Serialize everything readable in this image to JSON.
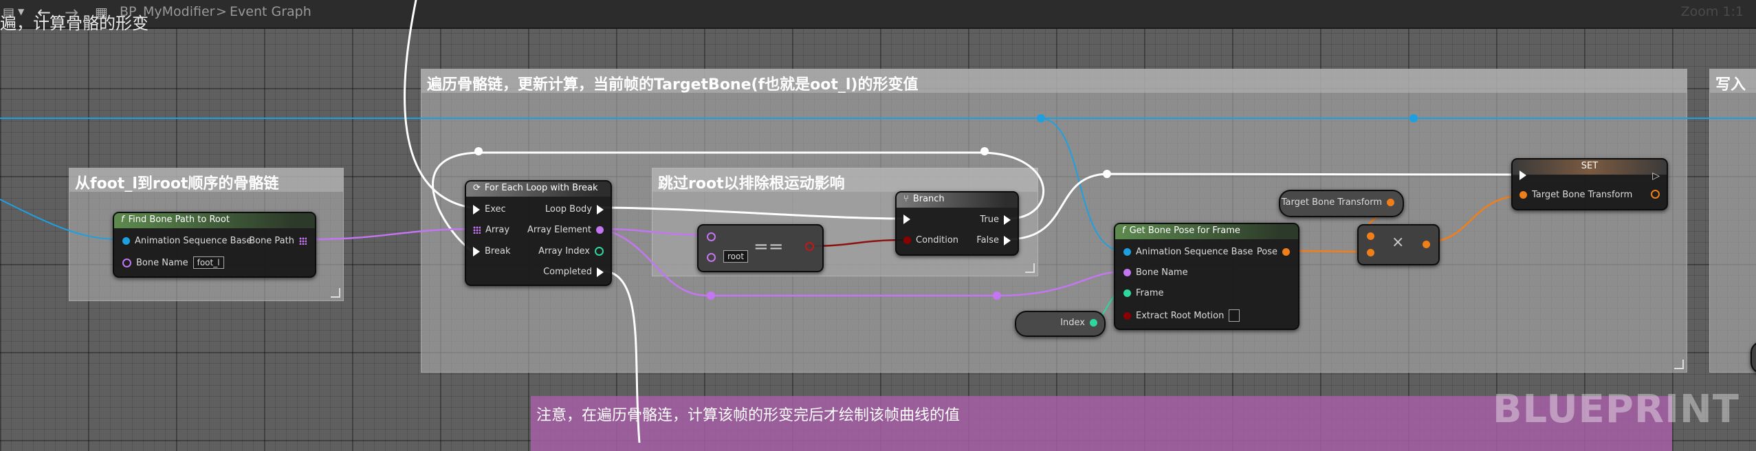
{
  "toolbar": {
    "background_comment": "遍，计算骨骼的形变",
    "blueprint_name": "BP_MyModifier",
    "separator": ">",
    "graph_name": "Event Graph",
    "zoom": "Zoom 1:1"
  },
  "comments": {
    "loop": "遍历骨骼链，更新计算，当前帧的TargetBone(f也就是oot_l)的形变值",
    "path": "从foot_l到root顺序的骨骼链",
    "skip": "跳过root以排除根运动影响",
    "write": "写入",
    "note": "注意，在遍历骨骼连，计算该帧的形变完后才绘制该帧曲线的值"
  },
  "nodes": {
    "find_path": {
      "title": "Find Bone Path to Root",
      "pin_anim": "Animation Sequence Base",
      "pin_bone": "Bone Name",
      "bone_value": "foot_l",
      "pin_path": "Bone Path"
    },
    "for_each": {
      "title": "For Each Loop with Break",
      "exec": "Exec",
      "array": "Array",
      "break": "Break",
      "loop_body": "Loop Body",
      "array_element": "Array Element",
      "array_index": "Array Index",
      "completed": "Completed"
    },
    "equals": {
      "op": "==",
      "value": "root"
    },
    "branch": {
      "title": "Branch",
      "condition": "Condition",
      "true": "True",
      "false": "False"
    },
    "get_pose": {
      "title": "Get Bone Pose for Frame",
      "anim": "Animation Sequence Base",
      "bone": "Bone Name",
      "frame": "Frame",
      "root_motion": "Extract Root Motion",
      "pose": "Pose"
    },
    "index": {
      "label": "Index"
    },
    "target_get": {
      "label": "Target Bone Transform"
    },
    "multiply": {
      "op": "×"
    },
    "set": {
      "title": "SET",
      "target": "Target Bone Transform"
    }
  },
  "colors": {
    "exec": "#ffffff",
    "object": "#1ea0e0",
    "name": "#c476f2",
    "struct": "#f07f1a",
    "int": "#2fd6a0",
    "bool": "#8b0000"
  },
  "watermark": "BLUEPRINT"
}
